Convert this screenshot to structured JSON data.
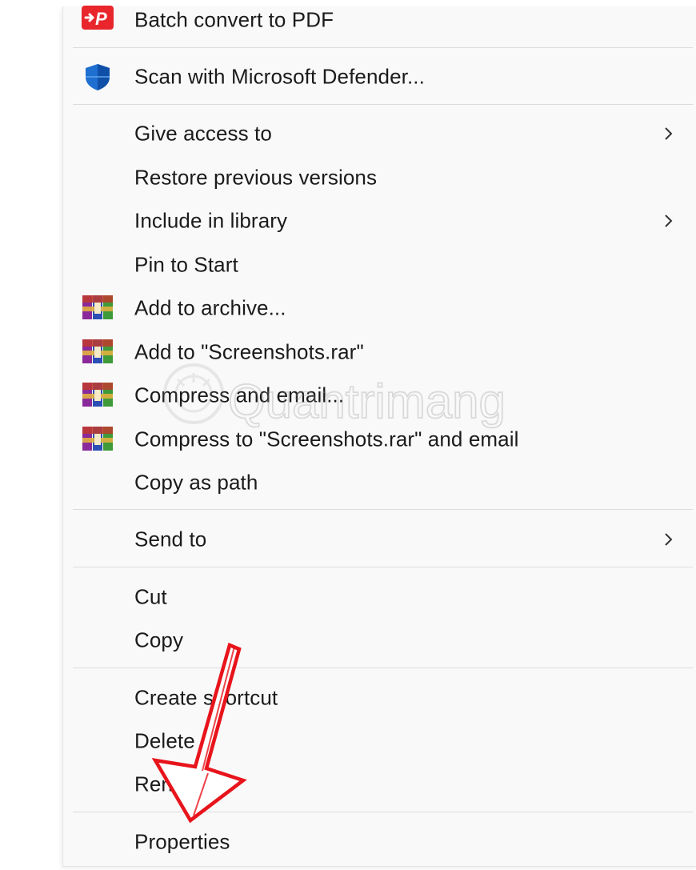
{
  "context_menu": {
    "items": [
      {
        "label": "Batch convert to PDF",
        "icon": "pdf-convert-icon"
      },
      {
        "label": "Scan with Microsoft Defender...",
        "icon": "defender-shield-icon"
      },
      {
        "label": "Give access to",
        "submenu": true
      },
      {
        "label": "Restore previous versions"
      },
      {
        "label": "Include in library",
        "submenu": true
      },
      {
        "label": "Pin to Start"
      },
      {
        "label": "Add to archive...",
        "icon": "winrar-icon"
      },
      {
        "label": "Add to \"Screenshots.rar\"",
        "icon": "winrar-icon"
      },
      {
        "label": "Compress and email...",
        "icon": "winrar-icon"
      },
      {
        "label": "Compress to \"Screenshots.rar\" and email",
        "icon": "winrar-icon"
      },
      {
        "label": "Copy as path"
      },
      {
        "label": "Send to",
        "submenu": true
      },
      {
        "label": "Cut"
      },
      {
        "label": "Copy"
      },
      {
        "label": "Create shortcut"
      },
      {
        "label": "Delete"
      },
      {
        "label": "Rename"
      },
      {
        "label": "Properties"
      }
    ],
    "submenu_icon": "chevron-right-icon"
  },
  "annotation": {
    "arrow_icon": "red-arrow-icon",
    "arrow_color": "#e8141c",
    "points_to": "Properties"
  },
  "watermark": {
    "text": "Quantrimang",
    "icon": "quantrimang-logo-icon"
  },
  "colors": {
    "menu_background": "#f9f9f9",
    "separator": "#dcdcdc",
    "text": "#1b1b1b",
    "pdf_icon_red": "#e8262b",
    "defender_blue": "#1f6fd1"
  }
}
